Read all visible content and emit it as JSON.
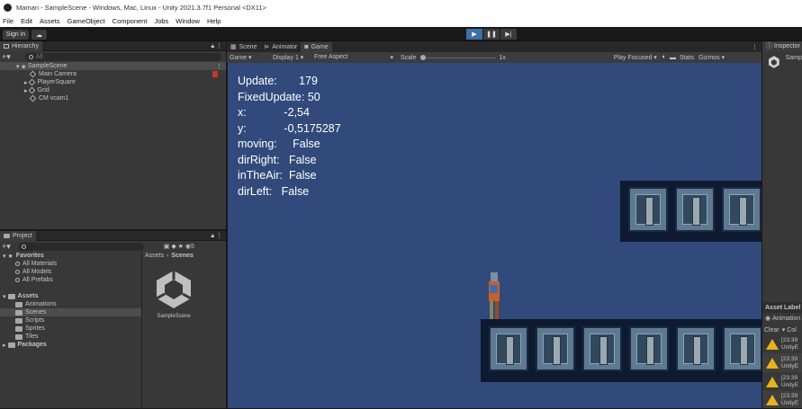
{
  "window": {
    "title": "Maman - SampleScene - Windows, Mac, Linux - Unity 2021.3.7f1 Personal <DX11>"
  },
  "menu": [
    "File",
    "Edit",
    "Assets",
    "GameObject",
    "Component",
    "Jobs",
    "Window",
    "Help"
  ],
  "toolbar": {
    "sign_in": "Sign in"
  },
  "hierarchy": {
    "title": "Hierarchy",
    "search_placeholder": "All",
    "scene": "SampleScene",
    "items": [
      "Main Camera",
      "PlayerSquare",
      "Grid",
      "CM vcam1"
    ]
  },
  "project": {
    "title": "Project",
    "favorites_label": "Favorites",
    "favorites": [
      "All Materials",
      "All Models",
      "All Prefabs"
    ],
    "assets_label": "Assets",
    "assets_children": [
      "Animations",
      "Scenes",
      "Scripts",
      "Sprites",
      "Tiles"
    ],
    "packages_label": "Packages",
    "breadcrumb": [
      "Assets",
      "Scenes"
    ],
    "scene_asset": "SampleScene",
    "hidden_count": "5"
  },
  "tabs": [
    "Scene",
    "Animator",
    "Game"
  ],
  "game_toolbar": {
    "display_mode": "Game",
    "display": "Display 1",
    "aspect": "Free Aspect",
    "scale_label": "Scale",
    "scale_value": "1x",
    "play_mode": "Play Focused",
    "stats": "Stats",
    "gizmos": "Gizmos"
  },
  "debug": {
    "lines": [
      {
        "label": "Update:",
        "value": "179"
      },
      {
        "label": "FixedUpdate:",
        "value": "50"
      },
      {
        "label": "x:",
        "value": "-2,54"
      },
      {
        "label": "y:",
        "value": "-0,5175287"
      },
      {
        "label": "moving:",
        "value": "False"
      },
      {
        "label": "dirRight:",
        "value": "False"
      },
      {
        "label": "inTheAir:",
        "value": "False"
      },
      {
        "label": "dirLeft:",
        "value": "False"
      }
    ]
  },
  "inspector": {
    "title": "Inspector",
    "object": "Samp"
  },
  "asset_labels": {
    "title": "Asset Label",
    "sub": "Animation"
  },
  "console": {
    "clear": "Clear",
    "collapse": "Col",
    "entries": [
      {
        "time": "[23:39",
        "source": "UnityE"
      },
      {
        "time": "[23:39",
        "source": "UnityE"
      },
      {
        "time": "[23:39",
        "source": "UnityE"
      },
      {
        "time": "[23:39",
        "source": "UnityE"
      }
    ]
  },
  "colors": {
    "game_bg": "#314a7b",
    "play_active": "#3c6fa8",
    "warning": "#e6b31e"
  }
}
